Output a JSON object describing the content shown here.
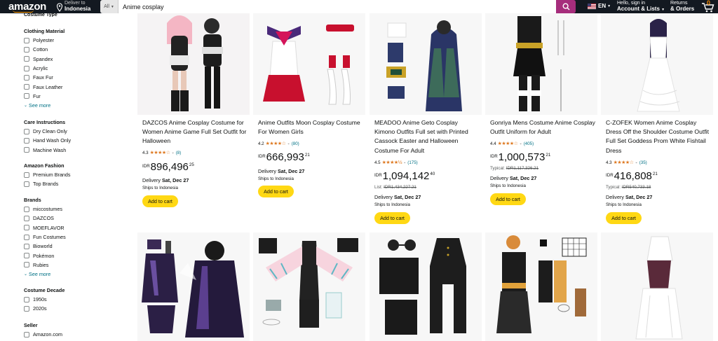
{
  "header": {
    "logo": "amazon",
    "deliver_line1": "Deliver to",
    "deliver_line2": "Indonesia",
    "search_category": "All",
    "search_value": "Anime cosplay",
    "lang": "EN",
    "account_line1": "Hello, sign in",
    "account_line2": "Account & Lists",
    "returns_line1": "Returns",
    "returns_line2": "& Orders",
    "cart_count": "0",
    "search_button_color": "#a62d7c"
  },
  "sidebar": {
    "cutoff_heading": "Costume Type",
    "groups": [
      {
        "title": "Clothing Material",
        "items": [
          "Polyester",
          "Cotton",
          "Spandex",
          "Acrylic",
          "Faux Fur",
          "Faux Leather",
          "Fur"
        ],
        "see_more": "See more"
      },
      {
        "title": "Care Instructions",
        "items": [
          "Dry Clean Only",
          "Hand Wash Only",
          "Machine Wash"
        ]
      },
      {
        "title": "Amazon Fashion",
        "items": [
          "Premium Brands",
          "Top Brands"
        ]
      },
      {
        "title": "Brands",
        "items": [
          "miccostumes",
          "DAZCOS",
          "MOEFLAVOR",
          "Fun Costumes",
          "Bioworld",
          "Pokémon",
          "Rubies"
        ],
        "see_more": "See more"
      },
      {
        "title": "Costume Decade",
        "items": [
          "1950s",
          "2020s"
        ]
      },
      {
        "title": "Seller",
        "items": [
          "Amazon.com"
        ]
      }
    ]
  },
  "products": [
    {
      "title": "DAZCOS Anime Cosplay Costume for Women Anime Game Full Set Outfit for Halloween",
      "rating": "4.3",
      "stars": "★★★★☆",
      "reviews": "(8)",
      "currency": "IDR",
      "price_whole": "896,496",
      "price_frac": "25",
      "delivery_label": "Delivery",
      "delivery_date": "Sat, Dec 27",
      "ships": "Ships to Indonesia",
      "add_to_cart": "Add to cart"
    },
    {
      "title": "Anime Outfits Moon Cosplay Costume For Women Girls",
      "rating": "4.2",
      "stars": "★★★★☆",
      "reviews": "(80)",
      "currency": "IDR",
      "price_whole": "666,993",
      "price_frac": "21",
      "delivery_label": "Delivery",
      "delivery_date": "Sat, Dec 27",
      "ships": "Ships to Indonesia",
      "add_to_cart": "Add to cart"
    },
    {
      "title": "MEADOO Anime Geto Cosplay Kimono Outfits Full set with Printed Cassock Easter and Halloween Costume For Adult",
      "rating": "4.5",
      "stars": "★★★★½",
      "reviews": "(175)",
      "currency": "IDR",
      "price_whole": "1,094,142",
      "price_frac": "40",
      "list_label": "List:",
      "list_price": "IDR1,434,227.21",
      "delivery_label": "Delivery",
      "delivery_date": "Sat, Dec 27",
      "ships": "Ships to Indonesia",
      "add_to_cart": "Add to cart"
    },
    {
      "title": "Gonriya Mens Costume Anime Cosplay Outfit Uniform for Adult",
      "rating": "4.4",
      "stars": "★★★★☆",
      "reviews": "(405)",
      "currency": "IDR",
      "price_whole": "1,000,573",
      "price_frac": "21",
      "list_label": "Typical:",
      "list_price": "IDR1,117,326.21",
      "delivery_label": "Delivery",
      "delivery_date": "Sat, Dec 27",
      "ships": "Ships to Indonesia",
      "add_to_cart": "Add to cart"
    },
    {
      "title": "C-ZOFEK Women Anime Cosplay Dress Off the Shoulder Costume Outfit Full Set Goddess Prom White Fishtail Dress",
      "rating": "4.3",
      "stars": "★★★★☆",
      "reviews": "(35)",
      "currency": "IDR",
      "price_whole": "416,808",
      "price_frac": "21",
      "list_label": "Typical:",
      "list_price": "IDR540,733.18",
      "delivery_label": "Delivery",
      "delivery_date": "Sat, Dec 27",
      "ships": "Ships to Indonesia",
      "add_to_cart": "Add to cart"
    }
  ]
}
